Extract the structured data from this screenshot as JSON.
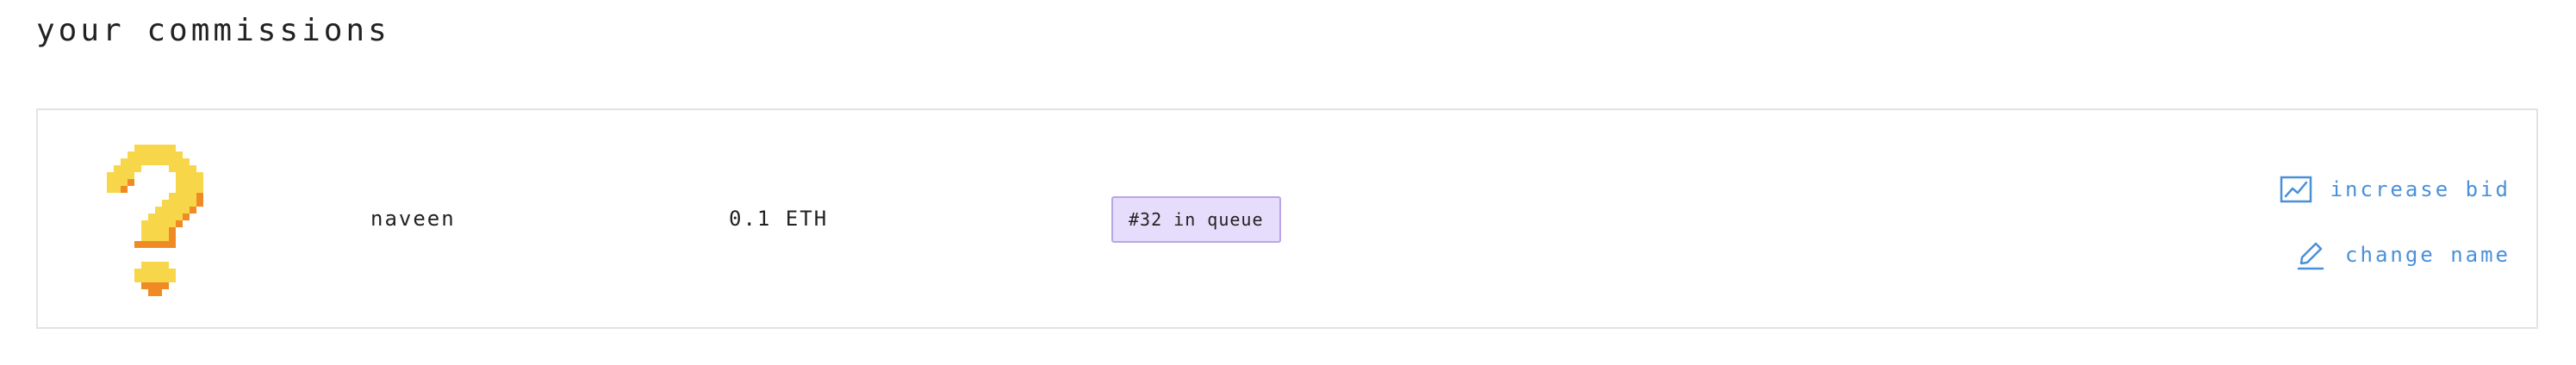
{
  "page": {
    "title": "your commissions"
  },
  "commissions": [
    {
      "avatar_icon": "pixel-question-mark-icon",
      "name": "naveen",
      "bid": "0.1 ETH",
      "queue_status": "#32 in queue",
      "actions": {
        "increase_bid": {
          "label": "increase bid",
          "icon": "chart-line-icon"
        },
        "change_name": {
          "label": "change name",
          "icon": "pencil-icon"
        }
      }
    }
  ],
  "colors": {
    "text": "#222222",
    "link": "#4a90d9",
    "badge_bg": "#e6dcfb",
    "badge_border": "#b9a6e6",
    "card_border": "#e3e3e3",
    "avatar_yellow": "#f7d749",
    "avatar_orange": "#f08a24"
  }
}
